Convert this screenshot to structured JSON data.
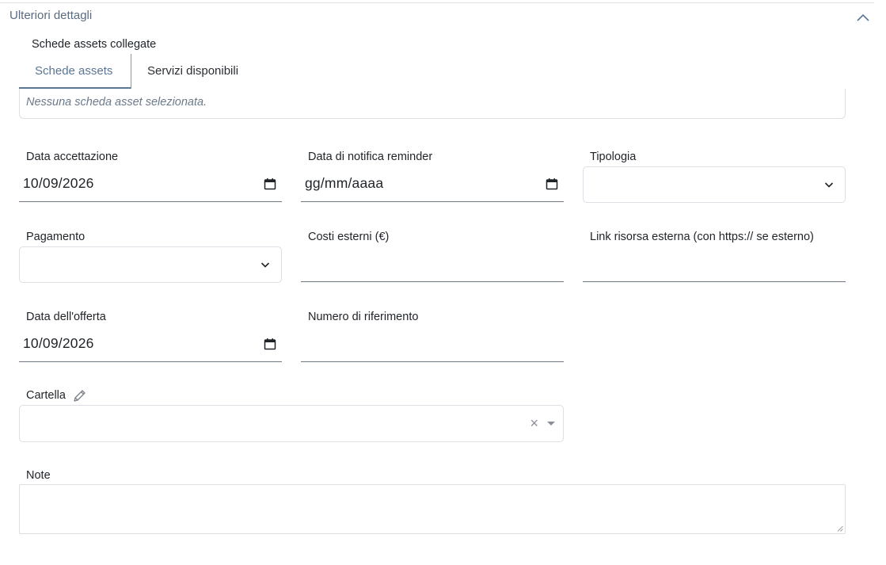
{
  "section": {
    "title": "Ulteriori dettagli",
    "collapse_icon": "chevron-up-icon"
  },
  "linked_assets": {
    "title": "Schede assets collegate",
    "tabs": [
      {
        "label": "Schede assets",
        "active": true
      },
      {
        "label": "Servizi disponibili",
        "active": false
      }
    ],
    "empty_message": "Nessuna scheda asset selezionata."
  },
  "form": {
    "data_accettazione": {
      "label": "Data accettazione",
      "value": "10/09/2026"
    },
    "data_notifica": {
      "label": "Data di notifica reminder",
      "value": "gg/mm/aaaa"
    },
    "tipologia": {
      "label": "Tipologia",
      "value": ""
    },
    "pagamento": {
      "label": "Pagamento",
      "value": ""
    },
    "costi_esterni": {
      "label": "Costi esterni (€)",
      "value": ""
    },
    "link_risorsa": {
      "label": "Link risorsa esterna (con https:// se esterno)",
      "value": ""
    },
    "data_offerta": {
      "label": "Data dell'offerta",
      "value": "10/09/2026"
    },
    "numero_riferimento": {
      "label": "Numero di riferimento",
      "value": ""
    },
    "cartella": {
      "label": "Cartella",
      "value": "",
      "clear_glyph": "×"
    },
    "note": {
      "label": "Note",
      "value": ""
    }
  },
  "colors": {
    "accent": "#5b7595",
    "border": "#dcdfe3",
    "muted_text": "#6b7a8a"
  }
}
